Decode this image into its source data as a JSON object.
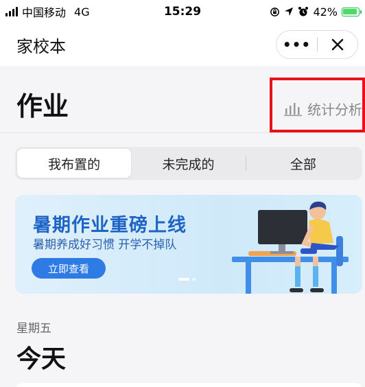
{
  "status_bar": {
    "carrier": "中国移动",
    "network": "4G",
    "time": "15:29",
    "battery": "42%"
  },
  "nav": {
    "title": "家校本",
    "more_icon": "more-dots-icon",
    "close_icon": "close-icon"
  },
  "header": {
    "title": "作业",
    "stats_label": "统计分析",
    "stats_icon": "bar-chart-icon",
    "highlight_color": "#e8111b"
  },
  "tabs": [
    {
      "label": "我布置的",
      "active": true
    },
    {
      "label": "未完成的",
      "active": false
    },
    {
      "label": "全部",
      "active": false
    }
  ],
  "banner": {
    "title": "暑期作业重磅上线",
    "subtitle": "暑期养成好习惯 开学不掉队",
    "button": "立即查看",
    "illustration": "student-at-computer-illustration"
  },
  "section": {
    "weekday": "星期五",
    "day": "今天"
  },
  "colors": {
    "accent": "#2f7be6",
    "banner_title": "#1e63c6"
  }
}
